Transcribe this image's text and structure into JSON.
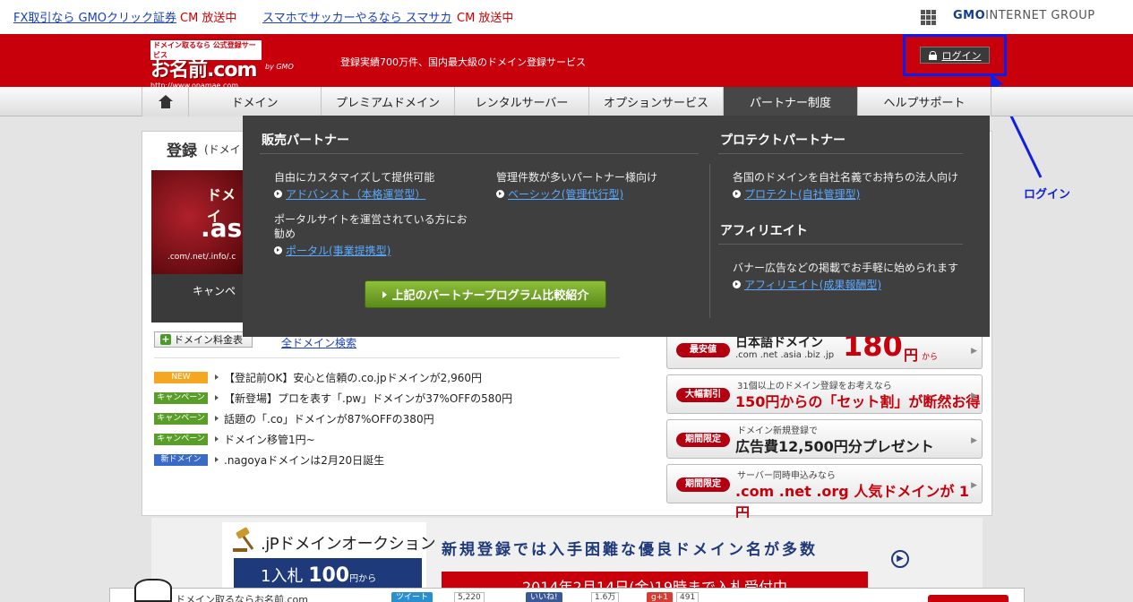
{
  "topbar": {
    "ad1_text": "FX取引なら GMOクリック証券",
    "ad1_cm": "CM 放送中",
    "ad2_text": "スマホでサッカーやるなら スマサカ",
    "ad2_cm": "CM 放送中",
    "brand_bold": "GMO",
    "brand_rest": "INTERNET GROUP"
  },
  "header": {
    "logo_top": "ドメイン取るなら 公式登録サービス",
    "logo_main": "お名前.com",
    "logo_url": "http://www.onamae.com",
    "by_gmo": "by GMO",
    "tagline": "登録実績700万件、国内最大級のドメイン登録サービス",
    "login_label": "ログイン"
  },
  "annotation": {
    "label": "ログイン",
    "color": "#1020d0"
  },
  "nav": {
    "items": [
      {
        "label": "ドメイン"
      },
      {
        "label": "プレミアムドメイン"
      },
      {
        "label": "レンタルサーバー"
      },
      {
        "label": "オプションサービス"
      },
      {
        "label": "パートナー制度"
      },
      {
        "label": "ヘルプサポート"
      }
    ],
    "active_index": 4
  },
  "main": {
    "section_title": "登録",
    "section_sub": "(ドメイ",
    "banner_line1": "ドメイ",
    "banner_line2": ".as",
    "banner_line3": ".com/.net/.info/.c",
    "banner_line4": "キャンペ",
    "price_table_label": "ドメイン料金表",
    "all_search_label": "全ドメイン検索",
    "news": [
      {
        "tag": "NEW",
        "tag_color": "#f5a623",
        "text": "【登記前OK】安心と信頼の.co.jpドメインが2,960円"
      },
      {
        "tag": "キャンペーン",
        "tag_color": "#5a9e2a",
        "text": "【新登場】プロを表す「.pw」ドメインが37%OFFの580円"
      },
      {
        "tag": "キャンペーン",
        "tag_color": "#5a9e2a",
        "text": "話題の「.co」ドメインが87%OFFの380円"
      },
      {
        "tag": "キャンペーン",
        "tag_color": "#5a9e2a",
        "text": "ドメイン移管1円~"
      },
      {
        "tag": "新ドメイン",
        "tag_color": "#3a6ac8",
        "text": ".nagoyaドメインは2月20日誕生"
      }
    ]
  },
  "promos": {
    "p1": {
      "badge": "最安値",
      "top": "日本語ドメイン",
      "bottom": ".com .net .asia .biz .jp",
      "price": "180",
      "yen": "円",
      "kara": "から"
    },
    "p2": {
      "badge": "大幅割引",
      "line1": "31個以上のドメイン登録をお考えなら",
      "line2": "150円からの「セット割」が断然お得"
    },
    "p3": {
      "badge": "期間限定",
      "line1": "ドメイン新規登録で",
      "line2": "広告費12,500円分プレゼント"
    },
    "p4": {
      "badge": "期間限定",
      "line1": "サーバー同時申込みなら",
      "line2": ".com .net .org 人気ドメインが 1円"
    }
  },
  "auction": {
    "title": ".jPドメインオークション",
    "bid_prefix": "1入札",
    "bid_price": "100",
    "bid_suffix": "円から",
    "headline": "新規登録では入手困難な優良ドメイン名が多数",
    "date": "2014年2月14日(金)19時まで入札受付中"
  },
  "social": {
    "text": "ドメイン取るならお名前.com",
    "tweet_label": "ツイート",
    "tweet_count": "5,220",
    "like_label": "いいね!",
    "like_count": "1.6万",
    "gplus_label": "g+1",
    "gplus_count": "491"
  },
  "dropdown": {
    "sales_heading": "販売パートナー",
    "col1_desc1": "自由にカスタマイズして提供可能",
    "col1_link1": "アドバンスト（本格運営型）",
    "col1_desc2a": "ポータルサイトを運営されている方にお",
    "col1_desc2b": "勧め",
    "col1_link2": "ポータル(事業提携型)",
    "col2_desc1": "管理件数が多いパートナー様向け",
    "col2_link1": "ベーシック(管理代行型)",
    "compare_button": "上記のパートナープログラム比較紹介",
    "protect_heading": "プロテクトパートナー",
    "protect_desc": "各国のドメインを自社名義でお持ちの法人向け",
    "protect_link": "プロテクト(自社管理型)",
    "affiliate_heading": "アフィリエイト",
    "affiliate_desc": "バナー広告などの掲載でお手軽に始められます",
    "affiliate_link": "アフィリエイト(成果報酬型)"
  }
}
